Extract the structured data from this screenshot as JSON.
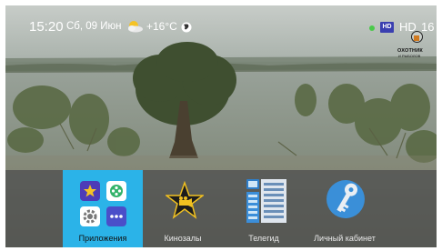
{
  "status": {
    "time": "15:20",
    "date": "Сб, 09 Июн",
    "temperature": "+16°C",
    "weather_icon": "partly-cloudy-icon",
    "network_icon": "globe-icon",
    "signal_indicator_color": "#4ac94a",
    "hd_badge": "HD",
    "channel_hd": "HD",
    "channel_number": "16"
  },
  "channel_logo": {
    "name": "ОХОТНИК",
    "subtitle": "И РЫБОЛОВ"
  },
  "menu": {
    "active_color": "#2bb3e8",
    "items": [
      {
        "label": "Приложения",
        "icon": "apps-grid-icon",
        "active": true
      },
      {
        "label": "Кинозалы",
        "icon": "movie-star-icon",
        "active": false
      },
      {
        "label": "Телегид",
        "icon": "tv-guide-icon",
        "active": false
      },
      {
        "label": "Личный кабинет",
        "icon": "key-icon",
        "active": false
      }
    ]
  }
}
